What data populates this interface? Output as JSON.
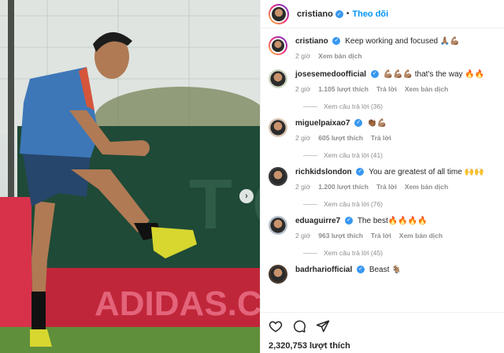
{
  "post": {
    "author": "cristiano",
    "follow_label": "Theo dõi",
    "caption": "Keep working and focused 🙏🏽💪🏽",
    "caption_time": "2 giờ",
    "caption_translate": "Xem bản dịch",
    "likes": "2,320,753 lượt thích"
  },
  "photo": {
    "banner_text": "ADIDAS.COM",
    "next_arrow": "›"
  },
  "comments": [
    {
      "user": "josesemedoofficial",
      "text": "💪🏽💪🏽💪🏽 that's the way 🔥🔥",
      "time": "2 giờ",
      "likes": "1.105 lượt thích",
      "reply": "Trả lời",
      "translate": "Xem bản dịch",
      "replies": "Xem câu trả lời (36)"
    },
    {
      "user": "miguelpaixao7",
      "text": "👏🏾💪🏽",
      "time": "2 giờ",
      "likes": "605 lượt thích",
      "reply": "Trả lời",
      "translate": "",
      "replies": "Xem câu trả lời (41)"
    },
    {
      "user": "richkidslondon",
      "text": "You are greatest of all time 🙌🙌",
      "time": "2 giờ",
      "likes": "1.200 lượt thích",
      "reply": "Trả lời",
      "translate": "Xem bản dịch",
      "replies": "Xem câu trả lời (76)"
    },
    {
      "user": "eduaguirre7",
      "text": "The best🔥🔥🔥🔥",
      "time": "2 giờ",
      "likes": "963 lượt thích",
      "reply": "Trả lời",
      "translate": "Xem bản dịch",
      "replies": "Xem câu trả lời (45)"
    },
    {
      "user": "badrhariofficial",
      "text": "Beast 🐐",
      "time": "",
      "likes": "",
      "reply": "",
      "translate": "",
      "replies": ""
    }
  ],
  "icons": [
    "heart-icon",
    "comment-icon",
    "share-icon"
  ],
  "colors": {
    "link": "#0095f6",
    "verified": "#3897f0",
    "muted": "#8e8e8e"
  }
}
